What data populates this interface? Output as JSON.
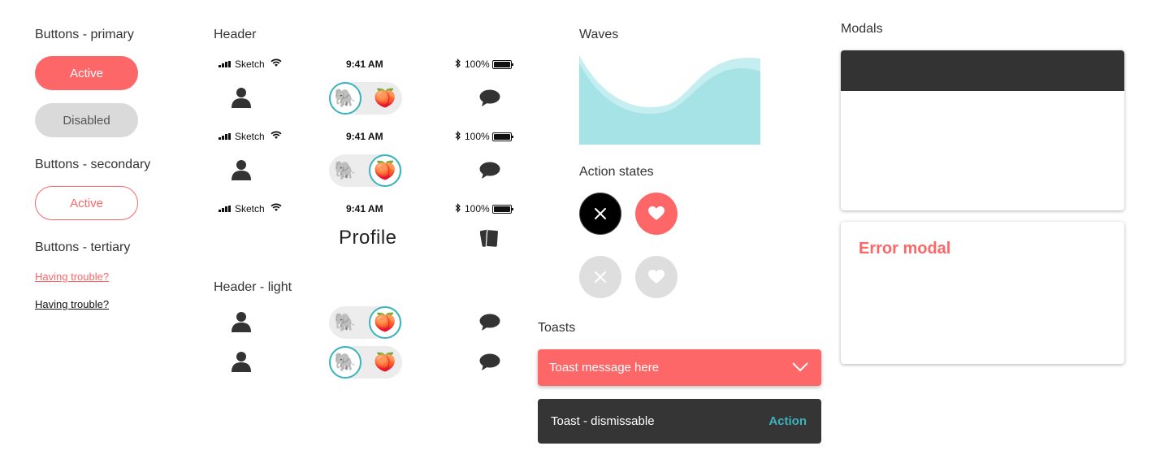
{
  "sections": {
    "buttons_primary": "Buttons - primary",
    "buttons_secondary": "Buttons - secondary",
    "buttons_tertiary": "Buttons - tertiary",
    "header": "Header",
    "header_light": "Header - light",
    "waves": "Waves",
    "action_states": "Action states",
    "toasts": "Toasts",
    "modals": "Modals"
  },
  "buttons": {
    "primary_active": "Active",
    "primary_disabled": "Disabled",
    "secondary_active": "Active",
    "tertiary_link_red": "Having trouble?",
    "tertiary_link_black": "Having trouble?"
  },
  "statusbar": {
    "carrier": "Sketch",
    "time": "9:41 AM",
    "battery": "100%"
  },
  "header": {
    "profile_title": "Profile",
    "toggle_left_emoji": "🐘",
    "toggle_right_emoji": "🍑"
  },
  "toasts": {
    "message": "Toast message here",
    "dismissable": "Toast - dismissable",
    "action": "Action"
  },
  "modals": {
    "error_title": "Error modal"
  },
  "colors": {
    "accent": "#fd6767",
    "teal": "#39b3bd",
    "wave_light": "#c5eef0",
    "wave_dark": "#a5e3e6",
    "dark": "#333333"
  },
  "icons": [
    "person-icon",
    "chat-bubble-icon",
    "cards-icon",
    "close-icon",
    "heart-icon",
    "chevron-down-icon",
    "wifi-icon",
    "bluetooth-icon",
    "battery-icon",
    "signal-icon"
  ]
}
